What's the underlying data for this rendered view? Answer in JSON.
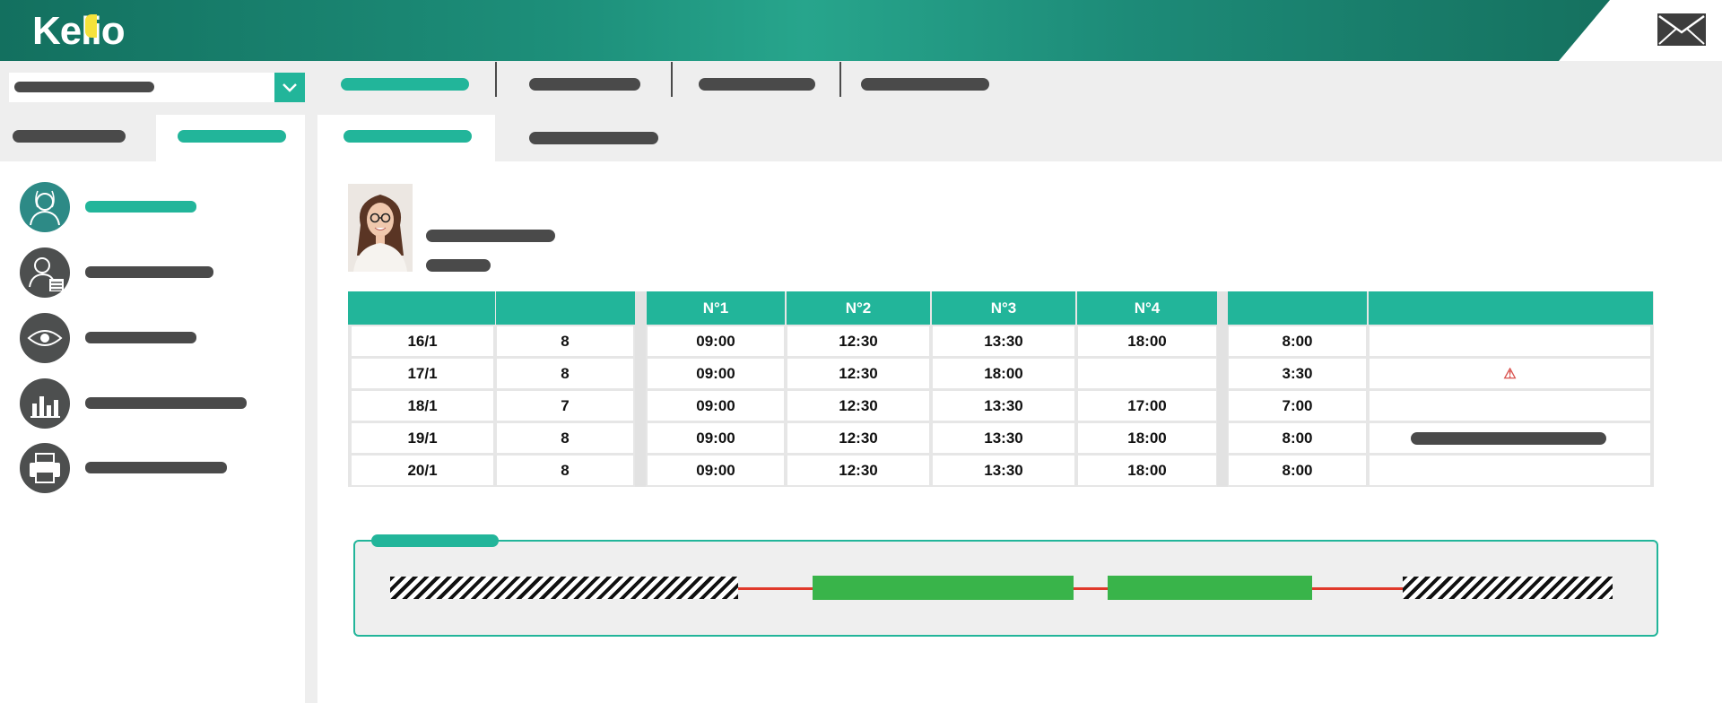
{
  "header": {
    "logo_text": "Keli",
    "logo_accent": "o",
    "brand_colors": {
      "primary": "#1d8f7a",
      "accent": "#22b59a",
      "logo_dot": "#f6e23b"
    },
    "icons": {
      "mail": "mail-icon"
    }
  },
  "sidebar": {
    "items": [
      {
        "icon": "doctor-icon",
        "active": true
      },
      {
        "icon": "user-list-icon",
        "active": false
      },
      {
        "icon": "eye-icon",
        "active": false
      },
      {
        "icon": "bar-chart-icon",
        "active": false
      },
      {
        "icon": "printer-icon",
        "active": false
      }
    ]
  },
  "table": {
    "headers": [
      "",
      "",
      "N°1",
      "N°2",
      "N°3",
      "N°4",
      "",
      ""
    ],
    "rows": [
      {
        "date": "16/1",
        "hours": "8",
        "n1": "09:00",
        "n2": "12:30",
        "n3": "13:30",
        "n4": "18:00",
        "total": "8:00",
        "status": ""
      },
      {
        "date": "17/1",
        "hours": "8",
        "n1": "09:00",
        "n2": "12:30",
        "n3": "18:00",
        "n4": "",
        "total": "3:30",
        "status": "⚠"
      },
      {
        "date": "18/1",
        "hours": "7",
        "n1": "09:00",
        "n2": "12:30",
        "n3": "13:30",
        "n4": "17:00",
        "total": "7:00",
        "status": ""
      },
      {
        "date": "19/1",
        "hours": "8",
        "n1": "09:00",
        "n2": "12:30",
        "n3": "13:30",
        "n4": "18:00",
        "total": "8:00",
        "status": ""
      },
      {
        "date": "20/1",
        "hours": "8",
        "n1": "09:00",
        "n2": "12:30",
        "n3": "13:30",
        "n4": "18:00",
        "total": "8:00",
        "status": ""
      }
    ]
  },
  "timeline": {
    "colors": {
      "work": "#39b44a",
      "gap": "#e0392b",
      "off": "hatched"
    }
  }
}
